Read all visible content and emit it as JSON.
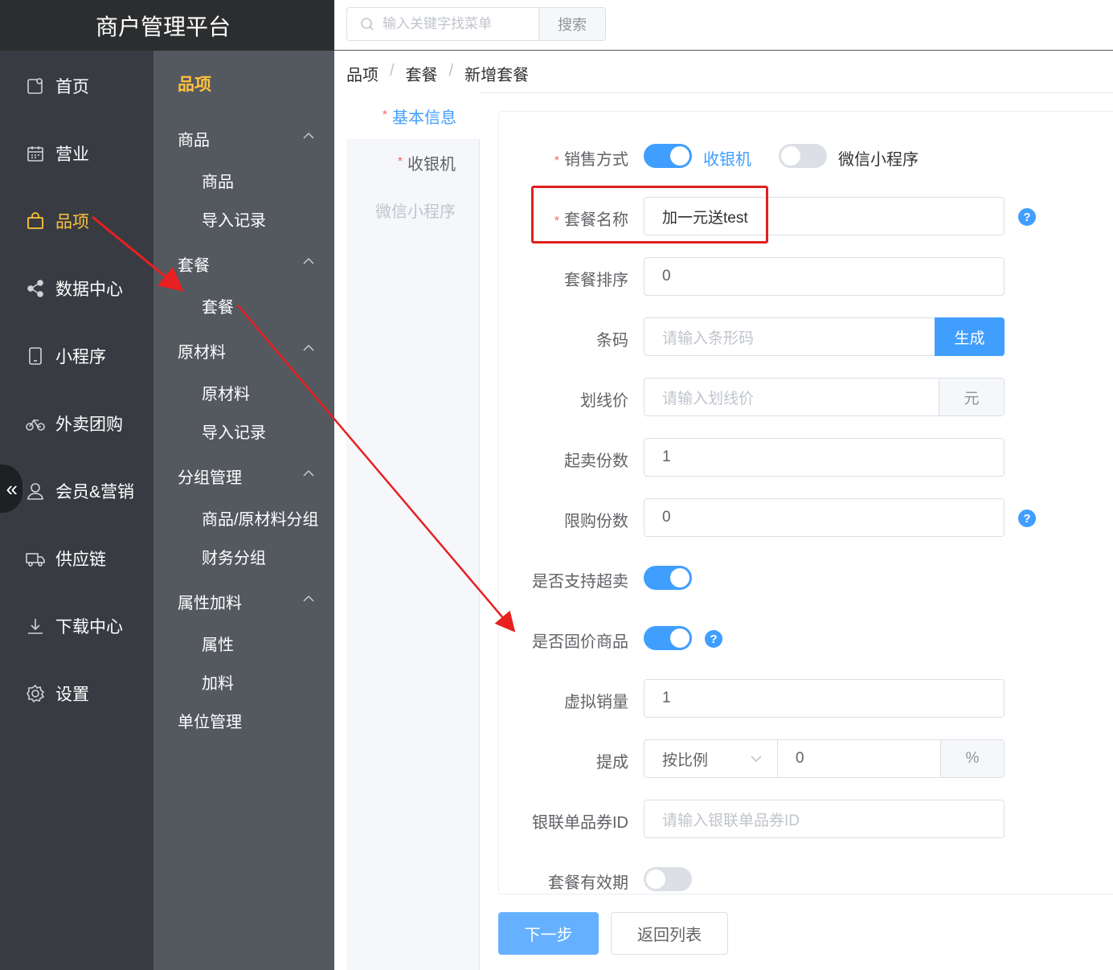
{
  "app": {
    "title": "商户管理平台"
  },
  "primary_nav": [
    {
      "label": "首页",
      "icon": "home-icon",
      "active": false
    },
    {
      "label": "营业",
      "icon": "calendar-icon",
      "active": false
    },
    {
      "label": "品项",
      "icon": "shopping-bag-icon",
      "active": true
    },
    {
      "label": "数据中心",
      "icon": "share-icon",
      "active": false
    },
    {
      "label": "小程序",
      "icon": "mobile-icon",
      "active": false
    },
    {
      "label": "外卖团购",
      "icon": "bicycle-icon",
      "active": false
    },
    {
      "label": "会员&营销",
      "icon": "user-icon",
      "active": false
    },
    {
      "label": "供应链",
      "icon": "truck-icon",
      "active": false
    },
    {
      "label": "下载中心",
      "icon": "download-icon",
      "active": false
    },
    {
      "label": "设置",
      "icon": "gear-icon",
      "active": false
    }
  ],
  "secondary_nav": {
    "title": "品项",
    "groups": [
      {
        "label": "商品",
        "items": [
          "商品",
          "导入记录"
        ]
      },
      {
        "label": "套餐",
        "items": [
          "套餐"
        ]
      },
      {
        "label": "原材料",
        "items": [
          "原材料",
          "导入记录"
        ]
      },
      {
        "label": "分组管理",
        "items": [
          "商品/原材料分组",
          "财务分组"
        ]
      },
      {
        "label": "属性加料",
        "items": [
          "属性",
          "加料"
        ]
      }
    ],
    "extra": "单位管理"
  },
  "search": {
    "placeholder": "输入关键字找菜单",
    "button": "搜索"
  },
  "breadcrumb": [
    "品项",
    "套餐",
    "新增套餐"
  ],
  "tabs": [
    {
      "label": "基本信息",
      "required": true,
      "active": true
    },
    {
      "label": "收银机",
      "required": true,
      "active": false
    },
    {
      "label": "微信小程序",
      "required": false,
      "disabled": true
    }
  ],
  "form": {
    "sale_mode": {
      "label": "销售方式",
      "opt1": "收银机",
      "opt1_on": true,
      "opt2": "微信小程序",
      "opt2_on": false
    },
    "name": {
      "label": "套餐名称",
      "value": "加一元送test"
    },
    "sort": {
      "label": "套餐排序",
      "value": "0"
    },
    "barcode": {
      "label": "条码",
      "placeholder": "请输入条形码",
      "button": "生成"
    },
    "strike_price": {
      "label": "划线价",
      "placeholder": "请输入划线价",
      "suffix": "元"
    },
    "min_qty": {
      "label": "起卖份数",
      "value": "1"
    },
    "limit_qty": {
      "label": "限购份数",
      "value": "0"
    },
    "oversell": {
      "label": "是否支持超卖",
      "on": true
    },
    "fixed_price": {
      "label": "是否固价商品",
      "on": true
    },
    "virtual_sales": {
      "label": "虚拟销量",
      "value": "1"
    },
    "commission": {
      "label": "提成",
      "mode": "按比例",
      "value": "0",
      "suffix": "%"
    },
    "unionpay": {
      "label": "银联单品券ID",
      "placeholder": "请输入银联单品券ID"
    },
    "validity": {
      "label": "套餐有效期",
      "on": false
    }
  },
  "actions": {
    "next": "下一步",
    "back": "返回列表"
  },
  "colors": {
    "primary": "#409eff",
    "active_nav": "#ffc23b",
    "annotation": "#e02020"
  }
}
